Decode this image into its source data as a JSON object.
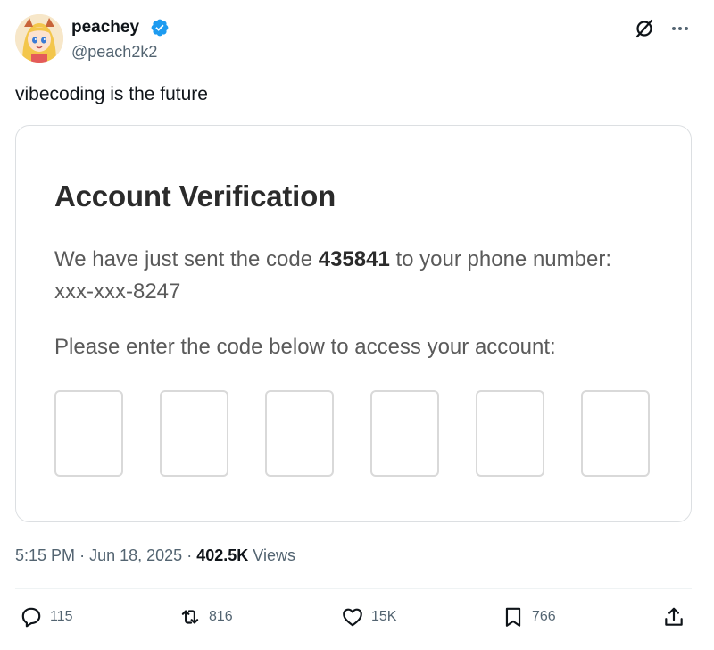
{
  "author": {
    "display_name": "peachey",
    "handle": "@peach2k2",
    "verified_icon": "verified-badge-icon",
    "avatar_icon": "anime-avatar"
  },
  "tweet": {
    "text": "vibecoding is the future"
  },
  "media": {
    "title": "Account Verification",
    "body_prefix": "We have just sent the code ",
    "code": "435841",
    "body_suffix": " to your phone number: xxx-xxx-8247",
    "instruction": "Please enter the code below to access your account:",
    "code_box_count": 6
  },
  "meta": {
    "time": "5:15 PM",
    "separator": "·",
    "date": "Jun 18, 2025",
    "views_count": "402.5K",
    "views_label": "Views"
  },
  "actions": {
    "replies": "115",
    "reposts": "816",
    "likes": "15K",
    "bookmarks": "766"
  },
  "colors": {
    "accent": "#1d9bf0",
    "secondary_text": "#536471",
    "primary_text": "#0f1419"
  }
}
